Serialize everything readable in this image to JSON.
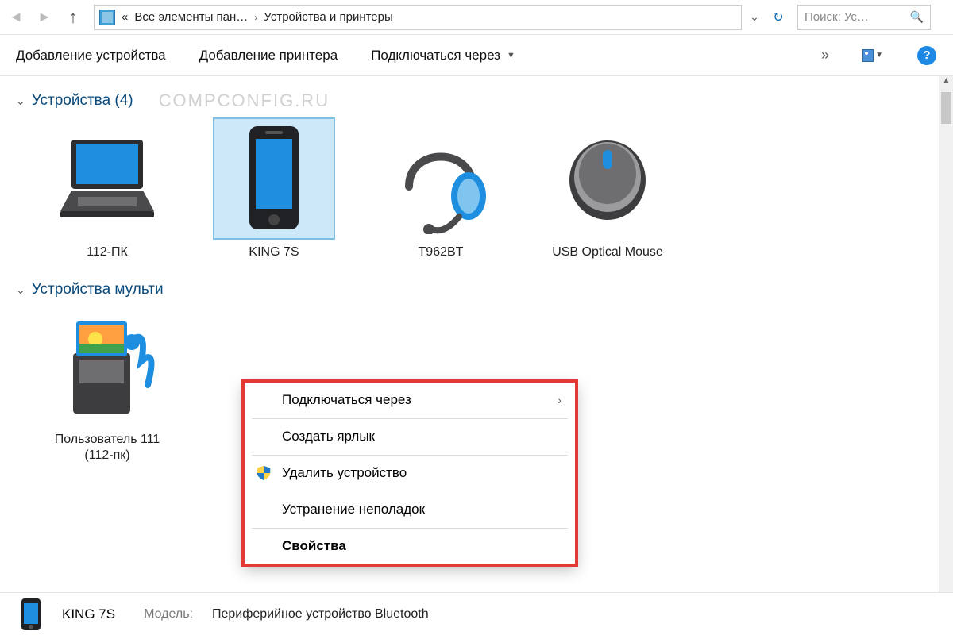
{
  "title_bar": {
    "back_enabled": false,
    "forward_enabled": false,
    "address": {
      "prefix_glyph": "«",
      "crumb1": "Все элементы пан…",
      "crumb2": "Устройства и принтеры"
    },
    "search_placeholder": "Поиск: Ус…"
  },
  "toolbar": {
    "add_device": "Добавление устройства",
    "add_printer": "Добавление принтера",
    "connect_via": "Подключаться через",
    "overflow_glyph": "»"
  },
  "watermark": "COMPCONFIG.RU",
  "groups": [
    {
      "title": "Устройства (4)",
      "selected_index": 1,
      "items": [
        {
          "label": "112-ПК",
          "icon": "laptop"
        },
        {
          "label": "KING 7S",
          "icon": "phone"
        },
        {
          "label": "T962BT",
          "icon": "bt-headset"
        },
        {
          "label": "USB Optical Mouse",
          "icon": "mouse"
        }
      ]
    },
    {
      "title": "Устройства мульти",
      "items": [
        {
          "label": "Пользователь 111 (112-пк)",
          "icon": "media"
        }
      ]
    }
  ],
  "context_menu": {
    "items": [
      {
        "label": "Подключаться через",
        "submenu": true
      },
      {
        "label": "Создать ярлык",
        "sep_above": true
      },
      {
        "label": "Удалить устройство",
        "sep_above": true,
        "shield": true
      },
      {
        "label": "Устранение неполадок"
      },
      {
        "label": "Свойства",
        "sep_above": true,
        "bold": true
      }
    ]
  },
  "details": {
    "name": "KING 7S",
    "model_label": "Модель:",
    "model_value": "Периферийное устройство Bluetooth"
  }
}
